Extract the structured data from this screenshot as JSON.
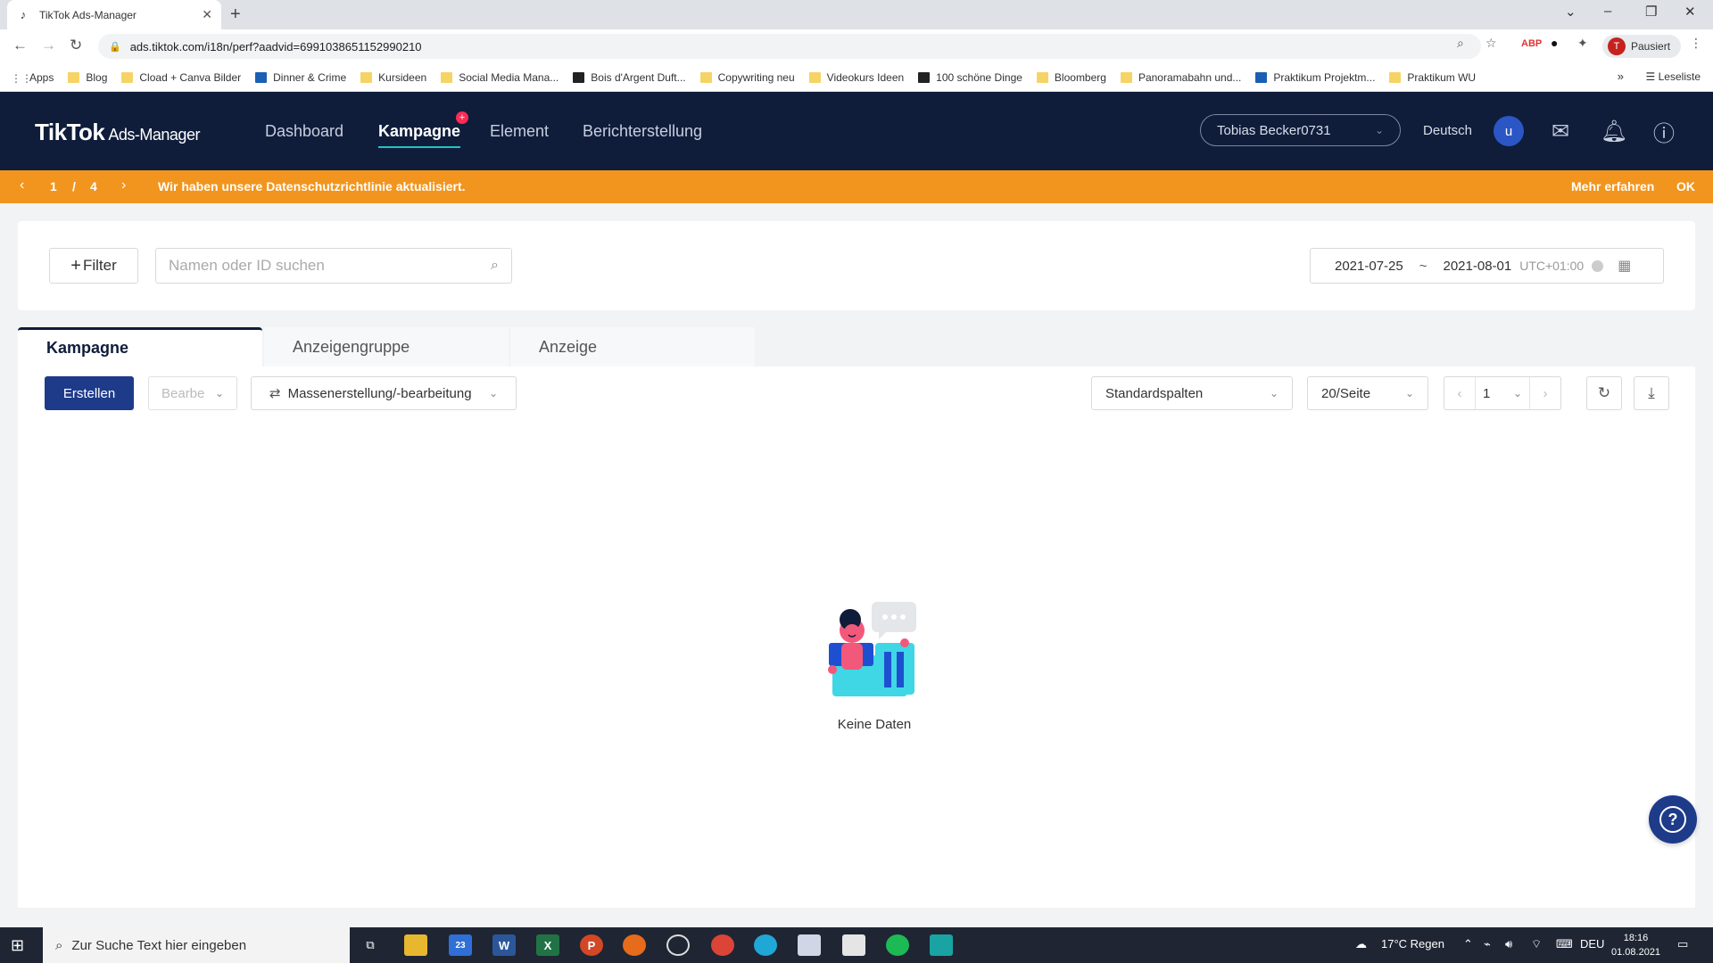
{
  "browser": {
    "tab_title": "TikTok Ads-Manager",
    "url": "ads.tiktok.com/i18n/perf?aadvid=6991038651152990210",
    "profile_label": "Pausiert",
    "profile_initial": "T",
    "reading_list": "Leseliste",
    "bookmarks": [
      "Apps",
      "Blog",
      "Cload + Canva Bilder",
      "Dinner & Crime",
      "Kursideen",
      "Social Media Mana...",
      "Bois d'Argent Duft...",
      "Copywriting neu",
      "Videokurs Ideen",
      "100 schöne Dinge",
      "Bloomberg",
      "Panoramabahn und...",
      "Praktikum Projektm...",
      "Praktikum WU"
    ]
  },
  "header": {
    "logo": "TikTok",
    "logo_sub": "Ads-Manager",
    "nav": [
      "Dashboard",
      "Kampagne",
      "Element",
      "Berichterstellung"
    ],
    "nav_badge": "+",
    "account": "Tobias Becker0731",
    "language": "Deutsch",
    "avatar_initial": "u"
  },
  "notice": {
    "page_current": "1",
    "page_sep": "/",
    "page_total": "4",
    "message": "Wir haben unsere Datenschutzrichtlinie aktualisiert.",
    "learn_more": "Mehr erfahren",
    "ok": "OK"
  },
  "filter": {
    "filter_label": "Filter",
    "search_placeholder": "Namen oder ID suchen",
    "date_start": "2021-07-25",
    "date_sep": "~",
    "date_end": "2021-08-01",
    "timezone": "UTC+01:00"
  },
  "tabs": [
    "Kampagne",
    "Anzeigengruppe",
    "Anzeige"
  ],
  "toolbar": {
    "create": "Erstellen",
    "edit": "Bearbe",
    "mass": "Massenerstellung/-bearbeitung",
    "columns": "Standardspalten",
    "per_page": "20/Seite",
    "page": "1"
  },
  "empty": {
    "text": "Keine Daten"
  },
  "taskbar": {
    "search_placeholder": "Zur Suche Text hier eingeben",
    "weather": "17°C  Regen",
    "lang": "DEU",
    "time": "18:16",
    "date": "01.08.2021",
    "mail_badge": "23"
  },
  "colors": {
    "header_bg": "#0f1d3b",
    "notice_bg": "#f2951e",
    "primary": "#1e3b8a",
    "accent": "#25c2c2",
    "badge": "#fe2c55"
  }
}
